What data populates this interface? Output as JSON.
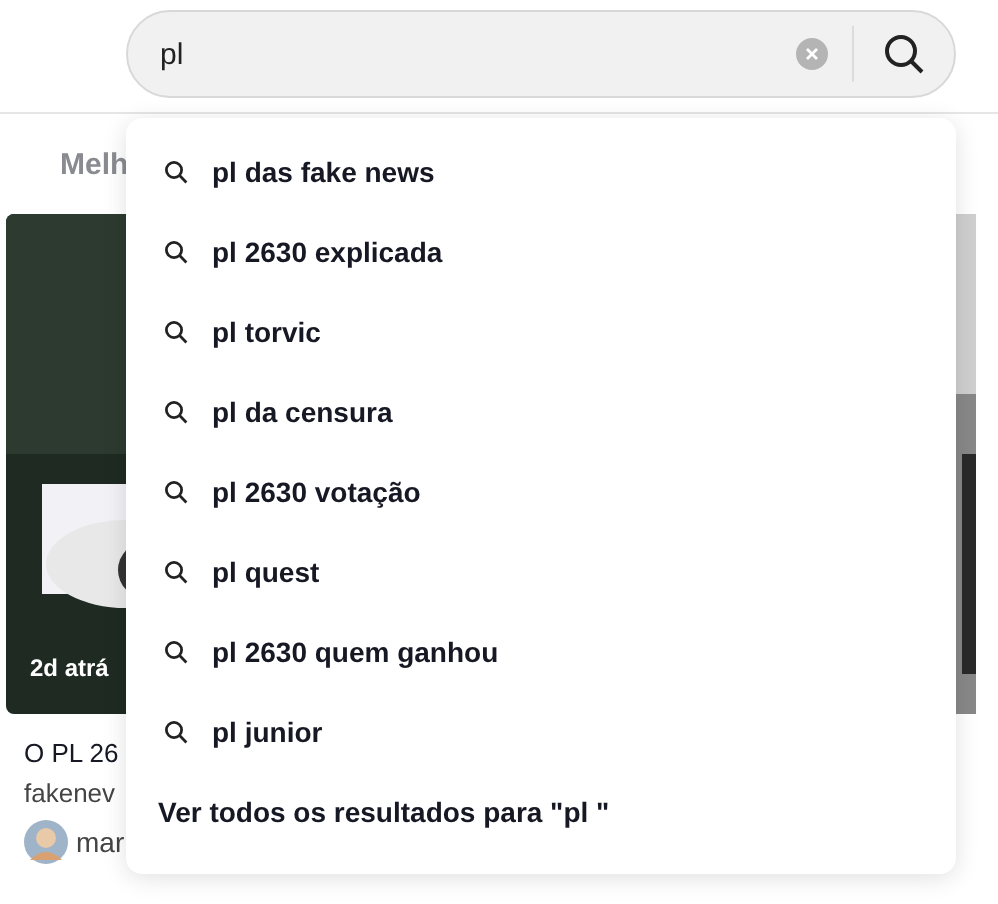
{
  "search": {
    "value": "pl"
  },
  "tabs": [
    {
      "label": "Melh"
    }
  ],
  "cards": [
    {
      "time": "2d atrá",
      "title": "O PL 26",
      "tags": "fakenev",
      "author": "mar"
    }
  ],
  "suggestions": [
    "pl das fake news",
    "pl 2630 explicada",
    "pl torvic",
    "pl da censura",
    "pl 2630 votação",
    "pl quest",
    "pl 2630 quem ganhou",
    "pl junior"
  ],
  "see_all": "Ver todos os resultados para \"pl \""
}
